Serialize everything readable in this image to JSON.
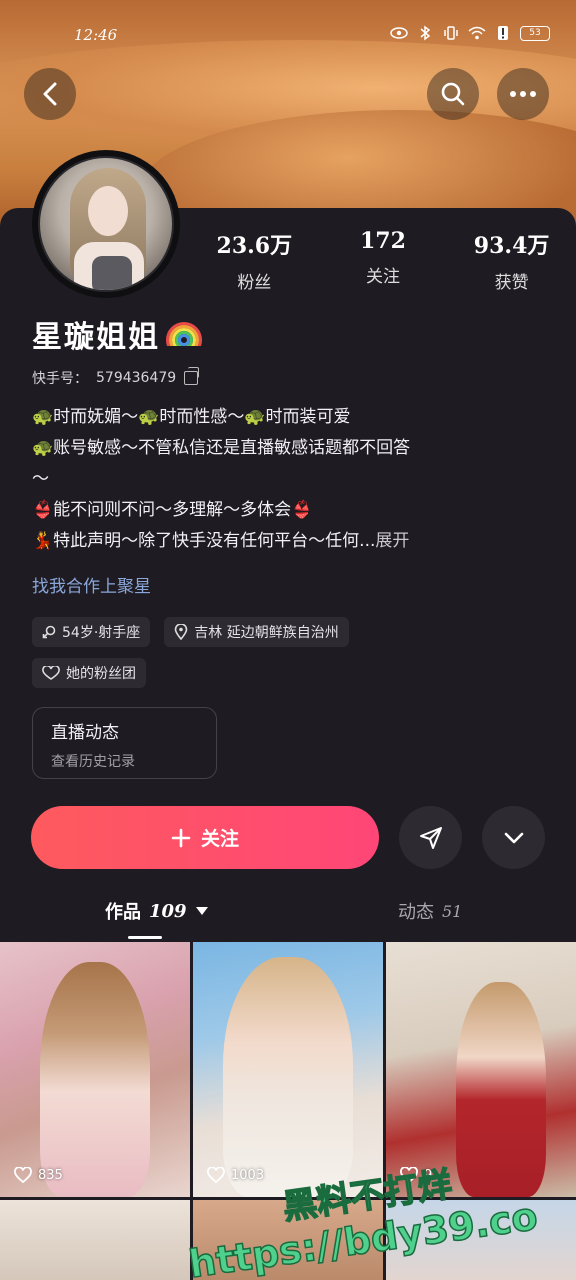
{
  "status_bar": {
    "time": "12:46",
    "battery": "53"
  },
  "profile": {
    "name": "星璇姐姐",
    "kuaishou_id_label": "快手号：",
    "kuaishou_id": "579436479",
    "stats": [
      {
        "value": "23.6万",
        "label": "粉丝"
      },
      {
        "value": "172",
        "label": "关注"
      },
      {
        "value": "93.4万",
        "label": "获赞"
      }
    ],
    "bio_lines": [
      "🐢时而妩媚～🐢时而性感～🐢时而装可爱",
      "🐢账号敏感～不管私信还是直播敏感话题都不回答",
      "～",
      "👙能不问则不问～多理解～多体会👙",
      "💃特此声明～除了快手没有任何平台～任何..."
    ],
    "expand_label": "展开",
    "collab_link": "找我合作上聚星",
    "tags": [
      {
        "icon": "gender-icon",
        "text": "54岁·射手座"
      },
      {
        "icon": "location-pin-icon",
        "text": "吉林 延边朝鲜族自治州"
      },
      {
        "icon": "heart-badge-icon",
        "text": "她的粉丝团"
      }
    ],
    "live_card": {
      "title": "直播动态",
      "subtitle": "查看历史记录"
    },
    "follow_label": "关注"
  },
  "tabs": [
    {
      "label": "作品",
      "count": "109",
      "active": true
    },
    {
      "label": "动态",
      "count": "51",
      "active": false
    }
  ],
  "posts": [
    {
      "likes": "835"
    },
    {
      "likes": "1003"
    },
    {
      "likes": "9"
    },
    {
      "likes": ""
    },
    {
      "likes": ""
    },
    {
      "likes": ""
    }
  ],
  "watermark": {
    "line1": "黑料不打烊",
    "line2": "https://bdy39.co"
  },
  "colors": {
    "accent_start": "#fe5a5e",
    "accent_end": "#ff4677",
    "link": "#8ba6d9",
    "background": "#1e1c22"
  }
}
